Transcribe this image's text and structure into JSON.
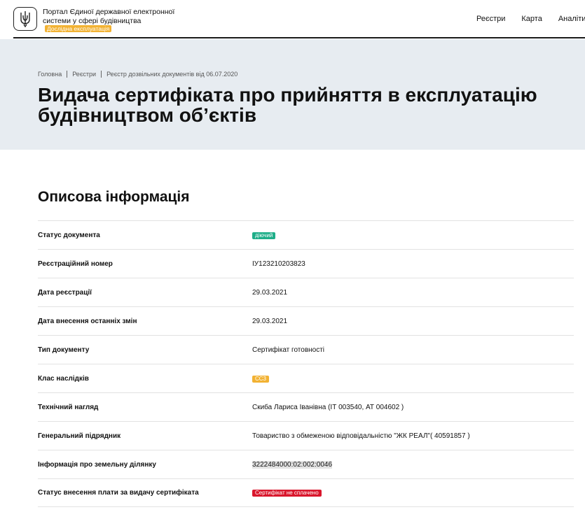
{
  "header": {
    "portal_title": "Портал Єдиної державної електронної системи у сфері будівництва",
    "pilot_badge": "Дослідна експлуатація",
    "nav": [
      "Реєстри",
      "Карта",
      "Аналіти"
    ]
  },
  "breadcrumb": [
    "Головна",
    "Реєстри",
    "Реєстр дозвільних документів від 06.07.2020"
  ],
  "page_title_line1": "Видача сертифіката про прийняття в експлуатацію",
  "page_title_line2": "будівництвом об’єктів",
  "section_title": "Описова інформація",
  "rows": [
    {
      "label": "Статус документа",
      "value": "діючий",
      "type": "pill",
      "color": "#1fae89"
    },
    {
      "label": "Реєстраційний номер",
      "value": "ІУ123210203823",
      "type": "text"
    },
    {
      "label": "Дата реєстрації",
      "value": "29.03.2021",
      "type": "text"
    },
    {
      "label": "Дата внесення останніх змін",
      "value": "29.03.2021",
      "type": "text"
    },
    {
      "label": "Тип документу",
      "value": "Сертифікат готовності",
      "type": "text"
    },
    {
      "label": "Клас наслідків",
      "value": "СС3",
      "type": "pill",
      "color": "#f2b233"
    },
    {
      "label": "Технічний нагляд",
      "value": "Скиба Лариса Іванівна (ІТ 003540, АТ 004602 )",
      "type": "text"
    },
    {
      "label": "Генеральний підрядник",
      "value": "Товариство з обмеженою відповідальністю \"ЖК РЕАЛ\"( 40591857 )",
      "type": "text"
    },
    {
      "label": "Інформація про земельну ділянку",
      "value": "3222484000:02:002:0046",
      "type": "highlight"
    },
    {
      "label": "Статус внесення плати за видачу сертифіката",
      "value": "Сертифікат не сплачено",
      "type": "pill",
      "color": "#d9162c"
    }
  ]
}
